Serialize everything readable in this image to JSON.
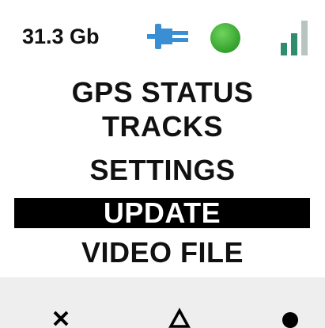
{
  "status": {
    "storage": "31.3 Gb",
    "power_icon": "plug-icon",
    "gps_fix_icon": "green-dot-icon",
    "signal_icon": "signal-bars-icon",
    "colors": {
      "plug": "#3a8fd4",
      "dot": "#3cb534",
      "bars_active": "#2f8c6e",
      "bars_inactive": "#b8c4c0"
    }
  },
  "menu": {
    "items": [
      {
        "label": "GPS STATUS",
        "selected": false
      },
      {
        "label": "TRACKS",
        "selected": false
      },
      {
        "label": "SETTINGS",
        "selected": false
      },
      {
        "label": "UPDATE",
        "selected": true
      },
      {
        "label": "VIDEO FILE",
        "selected": false
      }
    ]
  },
  "softkeys": {
    "left_icon": "close-icon",
    "center_icon": "triangle-icon",
    "right_icon": "circle-icon"
  }
}
